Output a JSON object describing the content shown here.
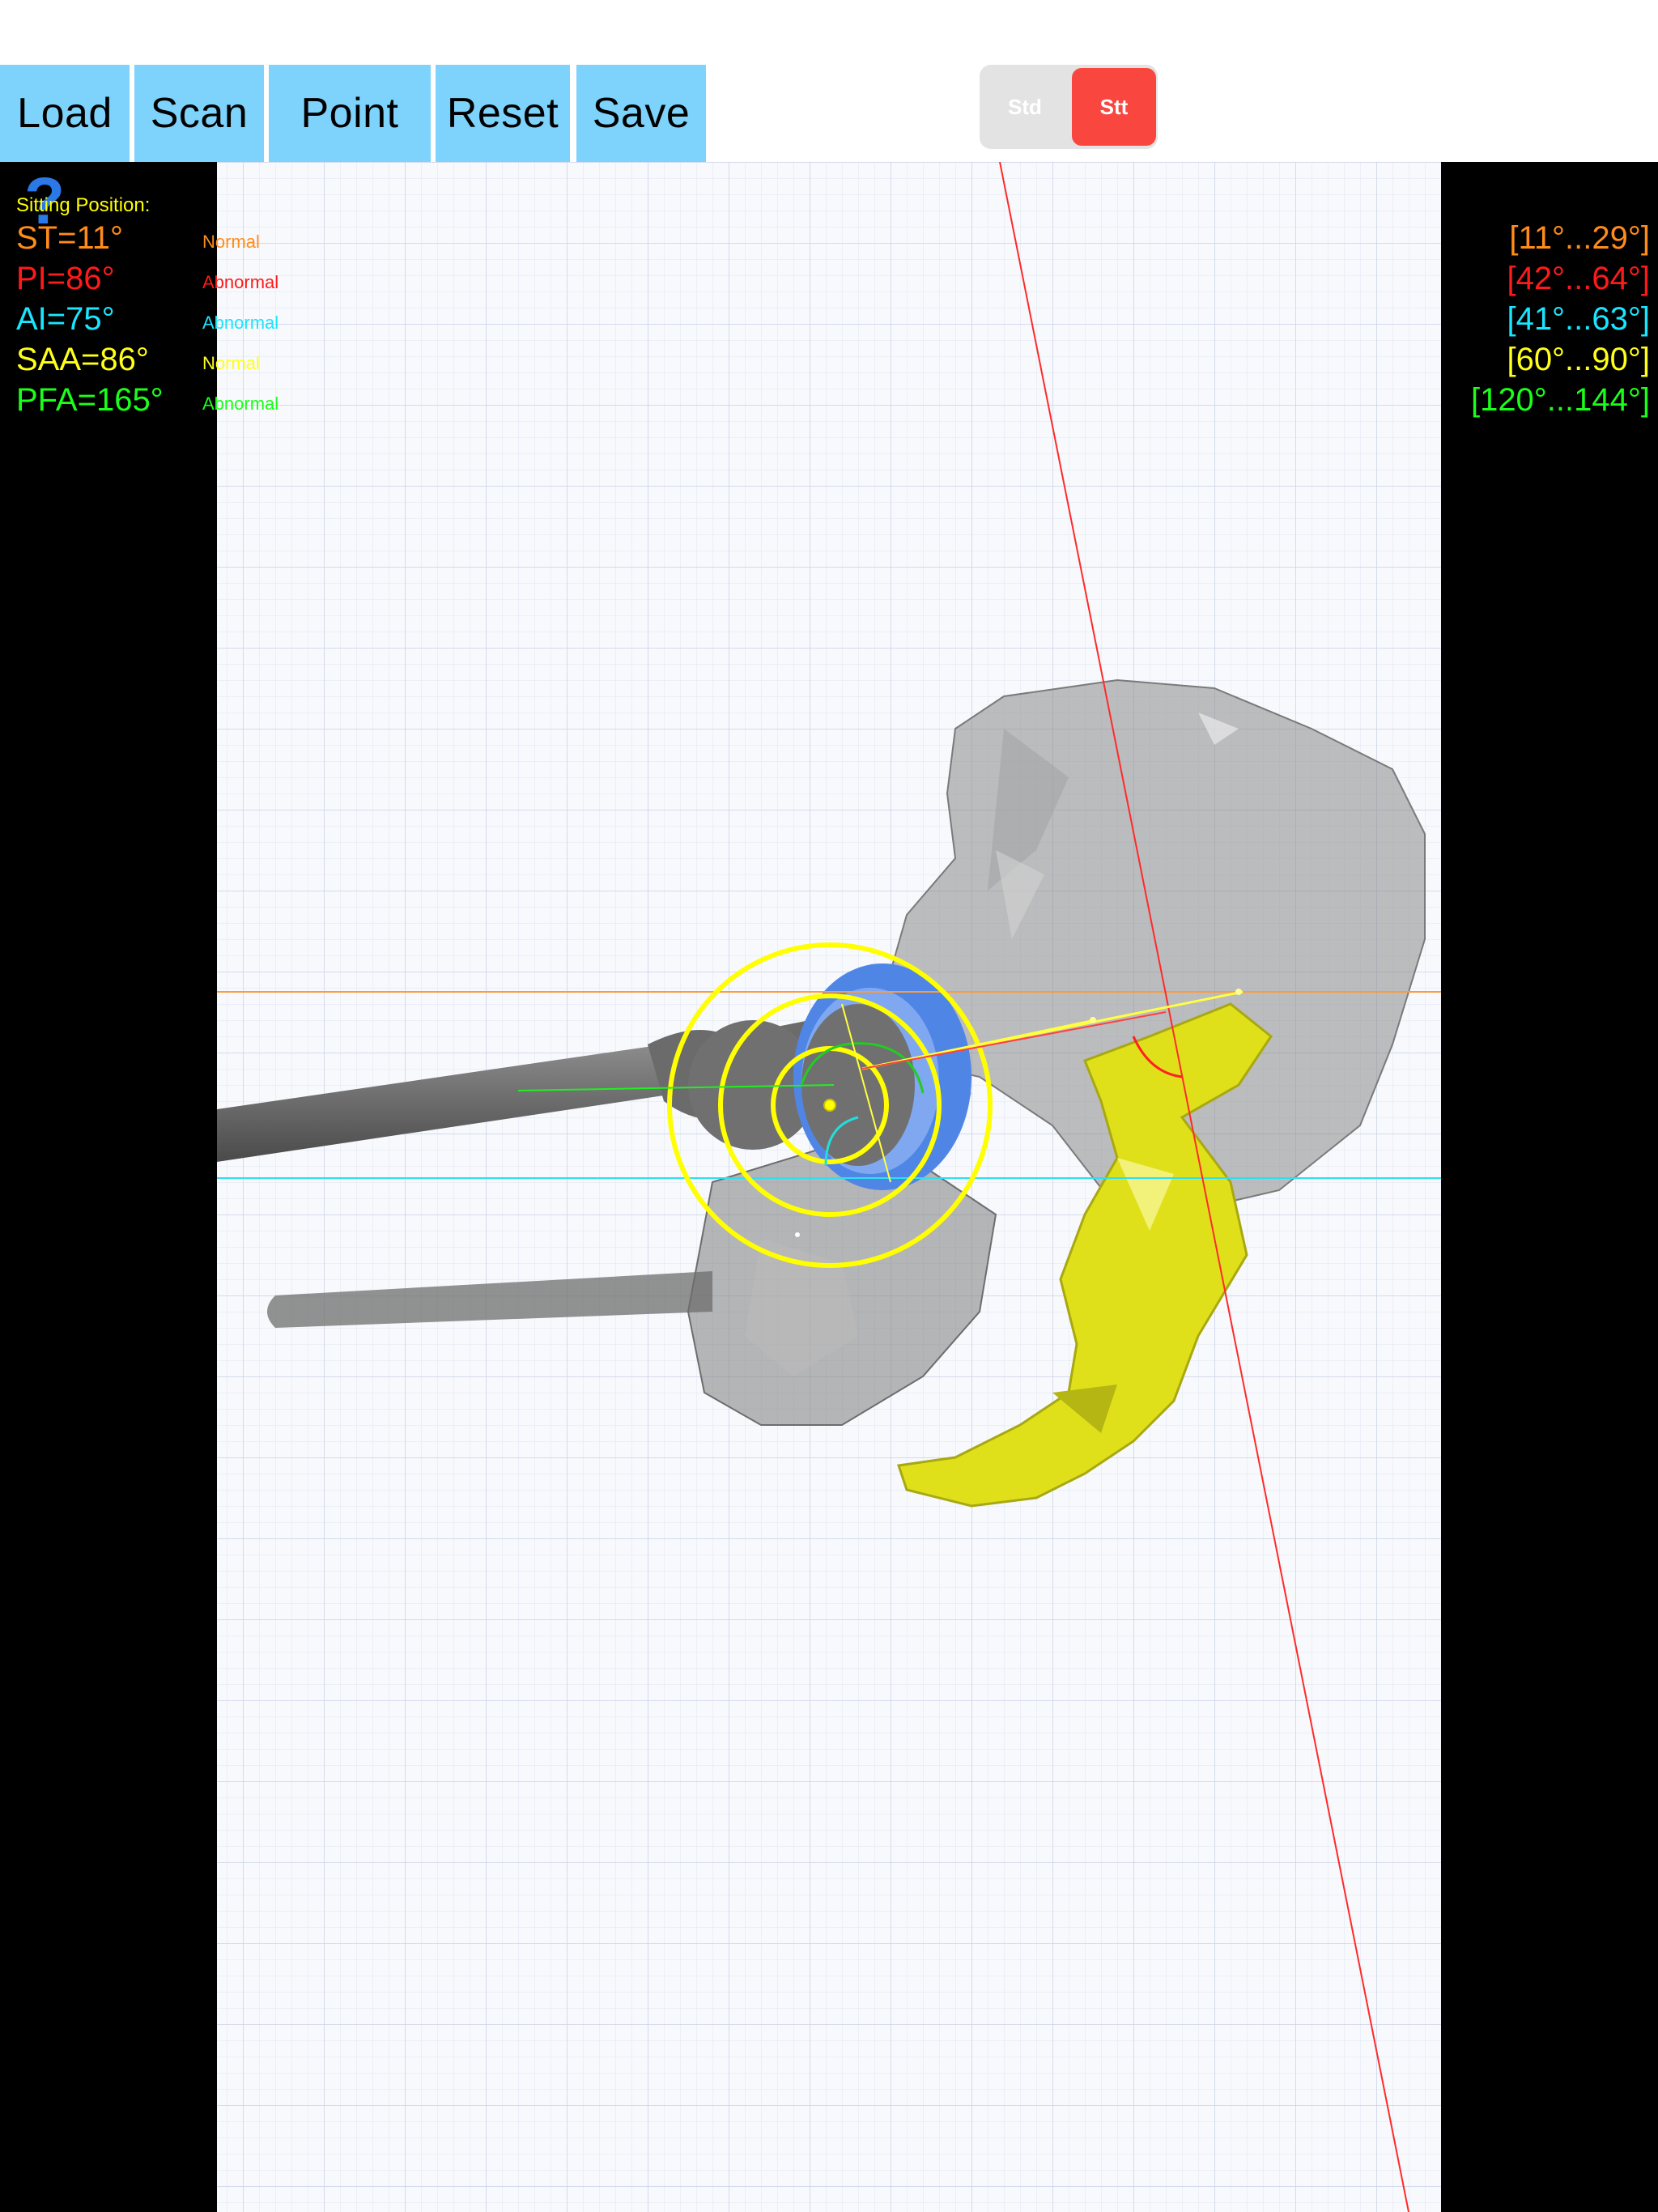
{
  "toolbar": {
    "buttons": [
      {
        "id": "load",
        "label": "Load"
      },
      {
        "id": "scan",
        "label": "Scan"
      },
      {
        "id": "point",
        "label": "Point"
      },
      {
        "id": "reset",
        "label": "Reset"
      },
      {
        "id": "save",
        "label": "Save"
      }
    ]
  },
  "mode_toggle": {
    "options": [
      "Std",
      "Stt"
    ],
    "selected": "Stt"
  },
  "help": {
    "icon": "question-mark-icon",
    "glyph": "?"
  },
  "measurements": {
    "position_label": "Sitting Position:",
    "items": [
      {
        "id": "st",
        "text": "ST=11°",
        "status": "Normal",
        "range": "[11°...29°]",
        "color": "#ff8c1a"
      },
      {
        "id": "pi",
        "text": "PI=86°",
        "status": "Abnormal",
        "range": "[42°...64°]",
        "color": "#ff1a1a"
      },
      {
        "id": "ai",
        "text": "AI=75°",
        "status": "Abnormal",
        "range": "[41°...63°]",
        "color": "#1ae5ff"
      },
      {
        "id": "saa",
        "text": "SAA=86°",
        "status": "Normal",
        "range": "[60°...90°]",
        "color": "#ffff1a"
      },
      {
        "id": "pfa",
        "text": "PFA=165°",
        "status": "Abnormal",
        "range": "[120°...144°]",
        "color": "#1aff1a"
      }
    ]
  },
  "colors": {
    "toolbar_button": "#7dd3fb",
    "toggle_active": "#f94740",
    "toggle_track": "#e3e3e3",
    "side_panel": "#000000",
    "bone": "#8a8a8a",
    "sacrum": "#e6e61a",
    "cup": "#5b8fe8",
    "grid": "#d4dbee"
  }
}
